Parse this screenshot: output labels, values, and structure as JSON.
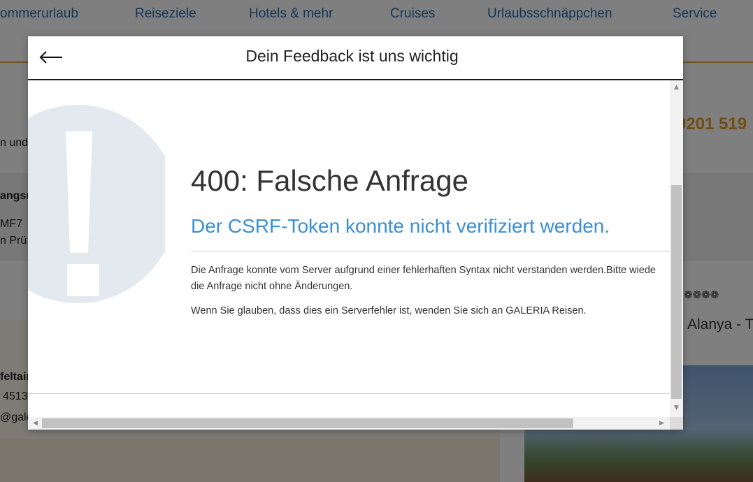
{
  "background": {
    "nav": [
      "ommerurlaub",
      "Reiseziele",
      "Hotels & mehr",
      "Cruises",
      "Urlaubsschnäppchen",
      "Service"
    ],
    "phone": "0201 519",
    "fragments": {
      "comma": "",
      "und": "n und",
      "angs": "angsn",
      "mf": "MF7",
      "prue": "n Prü",
      "feltain": "feltain",
      "num": "4513",
      "email": "@gale",
      "stars": "❁❁❁❁",
      "alanya": "Alanya - T"
    }
  },
  "modal": {
    "back_icon": "arrow-left-icon",
    "title": "Dein Feedback ist uns wichtig",
    "error": {
      "icon": "exclamation-icon",
      "title": "400: Falsche Anfrage",
      "subtitle": "Der CSRF-Token konnte nicht verifiziert werden.",
      "paragraph1_line1": "Die Anfrage konnte vom Server aufgrund einer fehlerhaften Syntax nicht verstanden werden.Bitte wiede",
      "paragraph1_line2": "die Anfrage nicht ohne Änderungen.",
      "paragraph2": "Wenn Sie glauben, dass dies ein Serverfehler ist, wenden Sie sich an GALERIA Reisen."
    }
  },
  "colors": {
    "nav_link": "#2b6cb0",
    "accent_orange": "#e59a1f",
    "error_subtitle": "#3a8fd6",
    "icon_circle": "#e2eaef"
  }
}
